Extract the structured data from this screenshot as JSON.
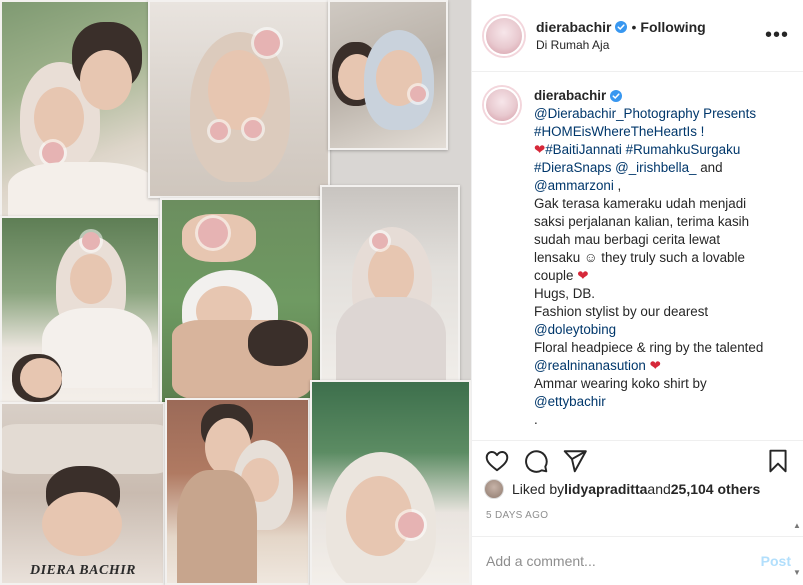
{
  "post": {
    "username": "dierabachir",
    "dot": "•",
    "follow_status": "Following",
    "location": "Di Rumah Aja",
    "more_label": "•••"
  },
  "collage": {
    "watermark": "DIERA BACHIR"
  },
  "caption": {
    "username": "dierabachir",
    "lines": [
      {
        "text": "@Dierabachir_Photography Presents",
        "kind": "link"
      },
      {
        "text": "#HOMEisWhereTheHeartIs !",
        "kind": "link"
      },
      {
        "text": "#BaitiJannati #RumahkuSurgaku",
        "kind": "link",
        "heart": "❤"
      },
      {
        "text_link": "#DieraSnaps @_irishbella_",
        "text_plain": " and",
        "kind": "mixed"
      },
      {
        "text_link": "@ammarzoni",
        "text_plain": " ,",
        "kind": "mixed"
      },
      {
        "text": "Gak terasa kameraku udah menjadi",
        "kind": "plain"
      },
      {
        "text": "saksi perjalanan kalian, terima kasih",
        "kind": "plain"
      },
      {
        "text": "sudah mau berbagi cerita lewat",
        "kind": "plain"
      },
      {
        "text": "lensaku ☺ they truly such a lovable",
        "kind": "plain"
      },
      {
        "text": "couple",
        "kind": "plain",
        "heart_after": "❤"
      },
      {
        "text": "Hugs, DB.",
        "kind": "plain"
      },
      {
        "text": "Fashion stylist by our dearest",
        "kind": "plain"
      },
      {
        "text": "@doleytobing",
        "kind": "link"
      },
      {
        "text": "Floral headpiece & ring by the talented",
        "kind": "plain"
      },
      {
        "text": "@realninanasution",
        "kind": "link",
        "heart_after": "❤"
      },
      {
        "text": "Ammar wearing koko shirt by",
        "kind": "plain"
      },
      {
        "text": "@ettybachir",
        "kind": "link"
      },
      {
        "text": ".",
        "kind": "plain"
      }
    ]
  },
  "actions": {
    "like_icon": "heart-icon",
    "comment_icon": "comment-icon",
    "share_icon": "share-icon",
    "save_icon": "bookmark-icon"
  },
  "likes": {
    "prefix": "Liked by ",
    "user": "lidyapraditta",
    "middle": " and ",
    "count": "25,104 others"
  },
  "timestamp": "5 DAYS AGO",
  "comment_box": {
    "placeholder": "Add a comment...",
    "post_label": "Post"
  },
  "colors": {
    "link": "#00376b",
    "verified": "#3897f0",
    "heart": "#d62839",
    "post_disabled": "#b2dffc"
  }
}
